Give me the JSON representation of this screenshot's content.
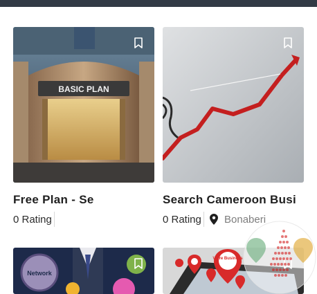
{
  "listings": [
    {
      "title": "Free Plan - Se",
      "rating": "0 Rating",
      "image_text": "BASIC PLAN",
      "bookmark_icon": "bookmark-icon"
    },
    {
      "title": "Search Cameroon Busi",
      "rating": "0 Rating",
      "location": "Bonaberi",
      "location_icon": "map-pin-icon",
      "bookmark_icon": "bookmark-icon"
    },
    {
      "image_text": "Network",
      "bookmark_icon": "bookmark-icon"
    },
    {
      "image_text": "Votre Business",
      "bookmark_icon": "bookmark-icon"
    }
  ],
  "colors": {
    "topbar": "#323a45",
    "title": "#1f1f1f",
    "muted": "#7d7d7d",
    "chart_line": "#c41f1f"
  }
}
